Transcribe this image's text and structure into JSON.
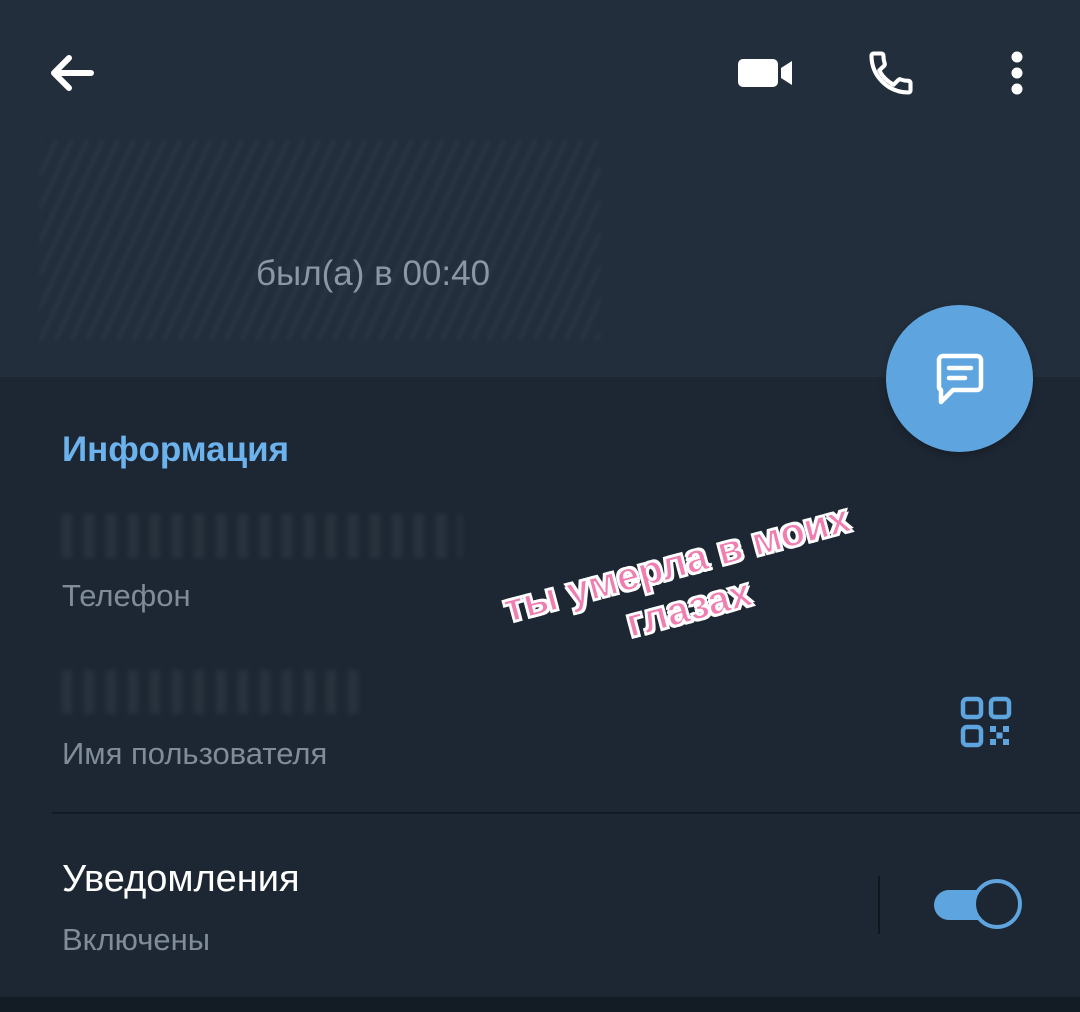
{
  "header": {
    "last_seen": "был(а) в 00:40"
  },
  "info": {
    "section_title": "Информация",
    "phone_label": "Телефон",
    "username_label": "Имя пользователя"
  },
  "notifications": {
    "title": "Уведомления",
    "status": "Включены",
    "enabled": true
  },
  "sticker": {
    "line1": "ты умерла в моих",
    "line2": "глазах"
  },
  "icons": {
    "back": "arrow-left-icon",
    "video": "video-camera-icon",
    "call": "phone-icon",
    "more": "more-vertical-icon",
    "message": "message-icon",
    "qr": "qr-code-icon"
  },
  "colors": {
    "accent": "#5ea5df",
    "section_title": "#6cb3ee",
    "header_bg": "#232e3c",
    "body_bg": "#1d2733",
    "sticker_text": "#f07eb0"
  }
}
